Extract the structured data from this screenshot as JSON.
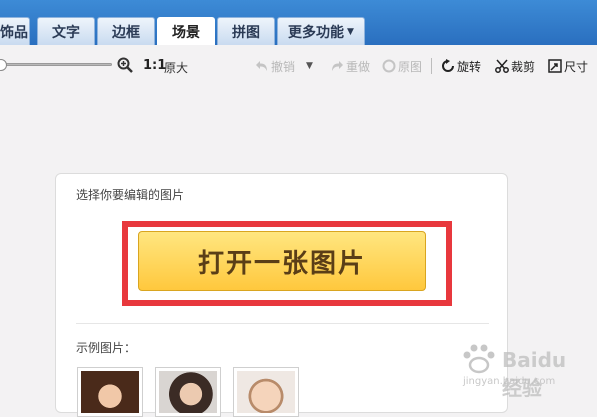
{
  "tabs": [
    {
      "label": "饰品"
    },
    {
      "label": "文字"
    },
    {
      "label": "边框"
    },
    {
      "label": "场景"
    },
    {
      "label": "拼图"
    },
    {
      "label": "更多功能"
    }
  ],
  "active_tab": "场景",
  "toolbar": {
    "ratio_label": "1:1",
    "original_size_label": "原大",
    "undo_label": "撤销",
    "redo_label": "重做",
    "original_label": "原图",
    "rotate_label": "旋转",
    "crop_label": "裁剪",
    "size_label": "尺寸"
  },
  "card": {
    "title": "选择你要编辑的图片",
    "open_button_label": "打开一张图片",
    "sample_label": "示例图片："
  },
  "watermark": {
    "brand": "Baidu 经验",
    "url": "jingyan.baidu.com"
  },
  "colors": {
    "tab_bar": "#2a6fbf",
    "highlight": "#e8383d",
    "button": "#ffc83d"
  }
}
